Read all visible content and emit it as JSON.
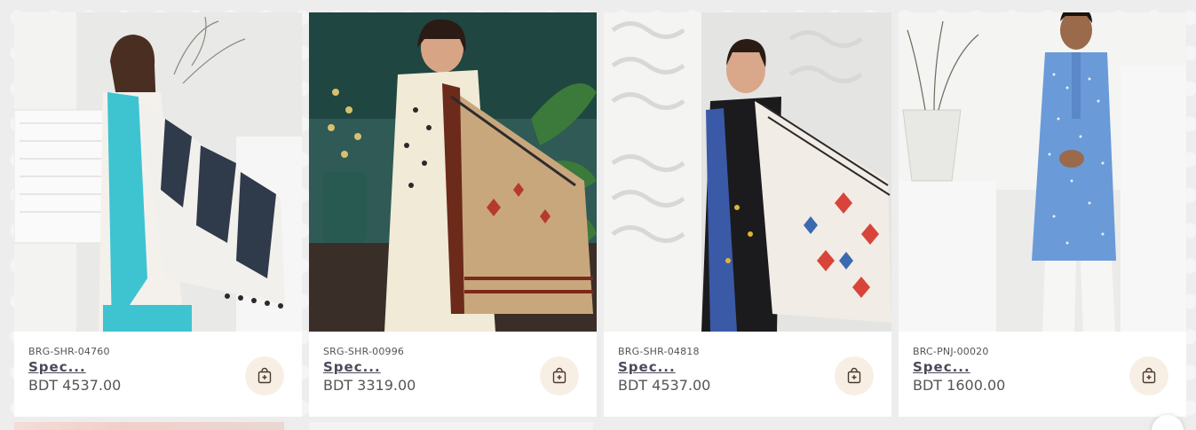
{
  "products": [
    {
      "sku": "BRG-SHR-04760",
      "name": "Spec...",
      "price": "BDT 4537.00",
      "image_alt": "Turquoise printed saree",
      "cart_icon": "shopping-bag-plus-icon"
    },
    {
      "sku": "SRG-SHR-00996",
      "name": "Spec...",
      "price": "BDT 3319.00",
      "image_alt": "Beige embroidered saree",
      "cart_icon": "shopping-bag-plus-icon"
    },
    {
      "sku": "BRG-SHR-04818",
      "name": "Spec...",
      "price": "BDT 4537.00",
      "image_alt": "Black and red printed saree",
      "cart_icon": "shopping-bag-plus-icon"
    },
    {
      "sku": "BRC-PNJ-00020",
      "name": "Spec...",
      "price": "BDT 1600.00",
      "image_alt": "Blue printed panjabi",
      "cart_icon": "shopping-bag-plus-icon"
    }
  ],
  "colors": {
    "cart_button_bg": "#f8efe4",
    "cart_icon": "#4a3a2e",
    "name_text": "#4a4a5a"
  }
}
